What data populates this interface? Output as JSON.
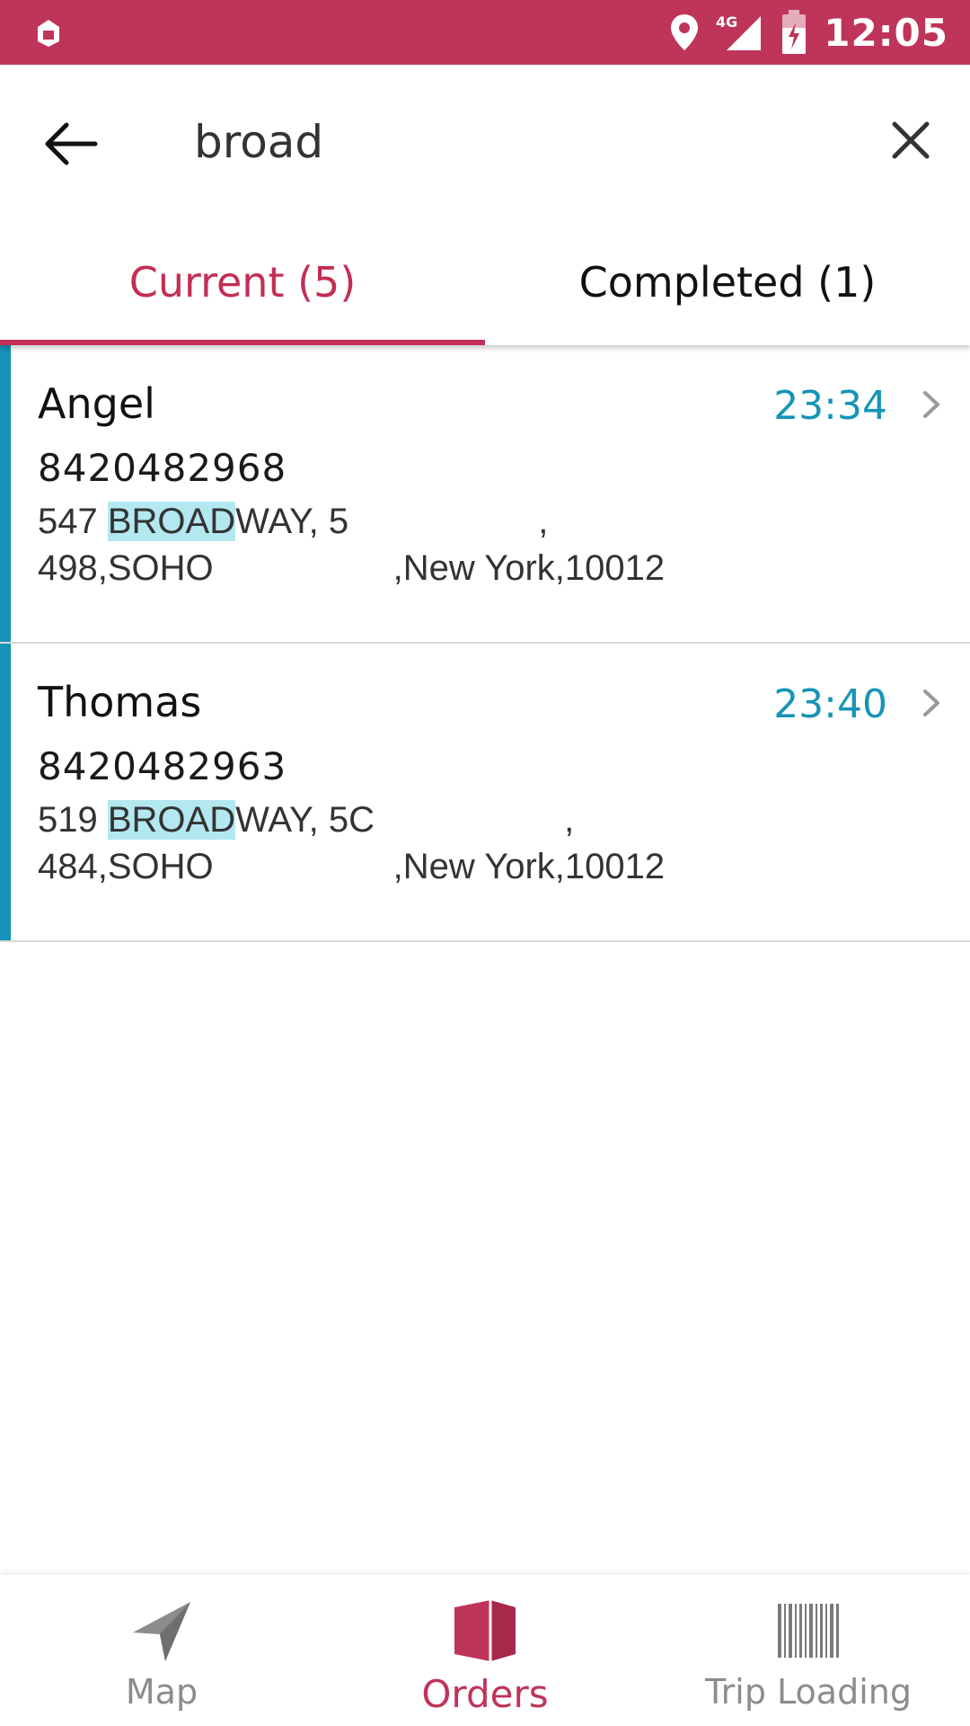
{
  "status_bar": {
    "time": "12:05",
    "network": "4G",
    "icons": [
      "app-notification-icon",
      "location-pin-icon",
      "signal-icon",
      "battery-charging-icon"
    ]
  },
  "search": {
    "value": "broad",
    "icons": [
      "back-arrow-icon",
      "close-icon"
    ]
  },
  "tabs": [
    {
      "label": "Current (5)",
      "active": true
    },
    {
      "label": "Completed (1)",
      "active": false
    }
  ],
  "colors": {
    "brand": "#bf3459",
    "accent": "#1694b6",
    "highlight": "#b3e8f0"
  },
  "orders": [
    {
      "name": "Angel",
      "phone": "8420482968",
      "time": "23:34",
      "address_line1_pre": "547 ",
      "address_line1_match": "BROAD",
      "address_line1_post": "WAY, 5                   ,",
      "address_line2": "498,SOHO                  ,New York,10012"
    },
    {
      "name": "Thomas",
      "phone": "8420482963",
      "time": "23:40",
      "address_line1_pre": "519 ",
      "address_line1_match": "BROAD",
      "address_line1_post": "WAY, 5C                   ,",
      "address_line2": "484,SOHO                  ,New York,10012"
    }
  ],
  "bottom_nav": [
    {
      "label": "Map",
      "icon": "navigation-arrow-icon",
      "active": false
    },
    {
      "label": "Orders",
      "icon": "box-icon",
      "active": true
    },
    {
      "label": "Trip Loading",
      "icon": "barcode-icon",
      "active": false
    }
  ]
}
